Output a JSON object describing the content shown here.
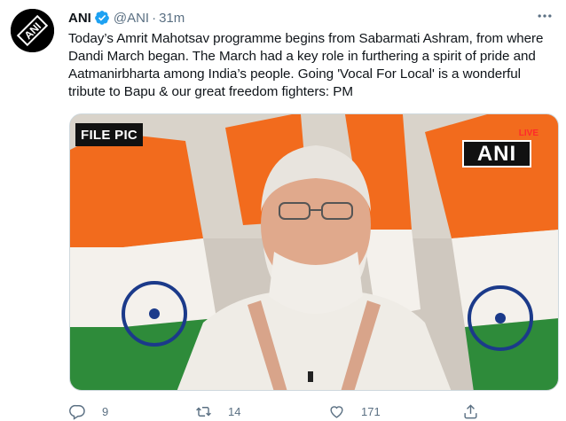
{
  "tweet": {
    "display_name": "ANI",
    "handle": "@ANI",
    "separator": "·",
    "time": "31m",
    "text": "Today’s Amrit Mahotsav programme begins from Sabarmati Ashram, from where Dandi March began. The March had a key role in furthering a spirit of pride and Aatmanirbharta among India’s people. Going 'Vocal For Local' is a wonderful tribute to Bapu & our great freedom fighters: PM",
    "avatar_logo_text": "ANI"
  },
  "media": {
    "file_pic_label": "FILE PIC",
    "live_label": "LIVE",
    "channel_logo": "ANI"
  },
  "actions": {
    "reply_count": "9",
    "retweet_count": "14",
    "like_count": "171"
  },
  "icons": {
    "reply": "reply-icon",
    "retweet": "retweet-icon",
    "like": "heart-icon",
    "share": "share-icon",
    "verified": "verified-badge-icon",
    "more": "more-icon"
  },
  "colors": {
    "verified_blue": "#1da1f2",
    "secondary_text": "#5b7083",
    "primary_text": "#0f1419",
    "saffron": "#f26b1d",
    "flag_green": "#2e8b3a",
    "chakra_blue": "#1b3a8a",
    "live_red": "#ff2a2a"
  }
}
